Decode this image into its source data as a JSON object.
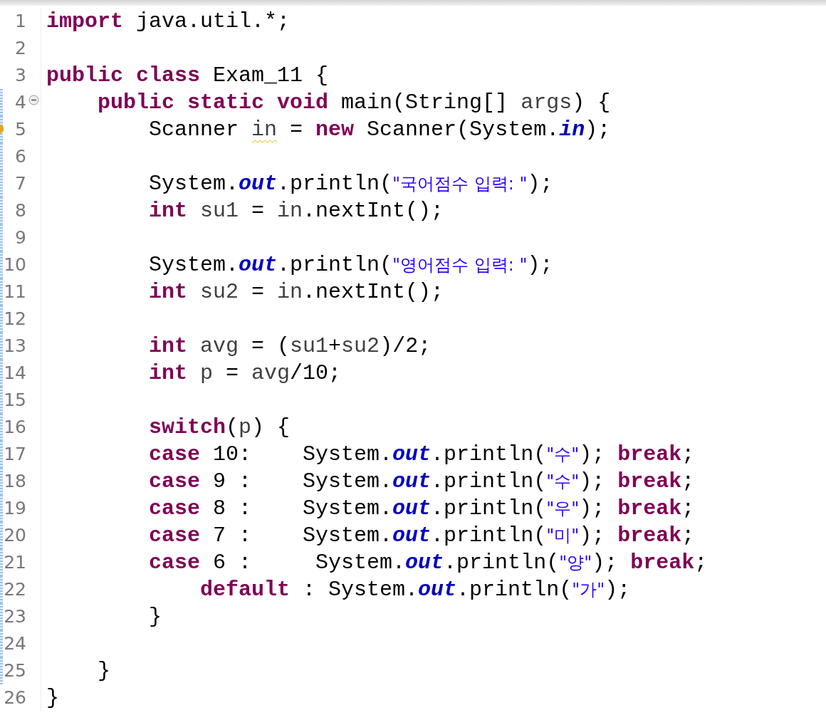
{
  "editor": {
    "lines": [
      {
        "number": "1",
        "changed": false,
        "foldable": false,
        "warning": false,
        "tokens": [
          {
            "kind": "keyword",
            "text": "import "
          },
          {
            "kind": "plain",
            "text": "java.util.*;"
          }
        ]
      },
      {
        "number": "2",
        "changed": false,
        "foldable": false,
        "warning": false
      },
      {
        "number": "3",
        "changed": false,
        "foldable": false,
        "warning": false,
        "tokens": [
          {
            "kind": "keyword",
            "text": "public class "
          },
          {
            "kind": "plain",
            "text": "Exam_11 {"
          }
        ]
      },
      {
        "number": "4",
        "changed": true,
        "foldable": true,
        "warning": false,
        "tokens": [
          {
            "kind": "keyword",
            "text": "    public static void "
          },
          {
            "kind": "plain",
            "text": "main(String[] "
          },
          {
            "kind": "variable",
            "text": "args"
          },
          {
            "kind": "plain",
            "text": ") {"
          }
        ]
      },
      {
        "number": "5",
        "changed": true,
        "foldable": false,
        "warning": true,
        "tokens": [
          {
            "kind": "plain",
            "text": "        Scanner "
          },
          {
            "kind": "warning",
            "text": "in"
          },
          {
            "kind": "plain",
            "text": " = "
          },
          {
            "kind": "keyword",
            "text": "new"
          },
          {
            "kind": "plain",
            "text": " Scanner(System."
          },
          {
            "kind": "field",
            "text": "in"
          },
          {
            "kind": "plain",
            "text": ");"
          }
        ]
      },
      {
        "number": "6",
        "changed": true,
        "foldable": false,
        "warning": false
      },
      {
        "number": "7",
        "changed": true,
        "foldable": false,
        "warning": false,
        "tokens": [
          {
            "kind": "plain",
            "text": "        System."
          },
          {
            "kind": "field",
            "text": "out"
          },
          {
            "kind": "plain",
            "text": ".println("
          },
          {
            "kind": "string",
            "text": "\"국어점수 입력: \""
          },
          {
            "kind": "plain",
            "text": ");"
          }
        ]
      },
      {
        "number": "8",
        "changed": true,
        "foldable": false,
        "warning": false,
        "tokens": [
          {
            "kind": "keyword",
            "text": "        int "
          },
          {
            "kind": "variable",
            "text": "su1"
          },
          {
            "kind": "plain",
            "text": " = "
          },
          {
            "kind": "variable",
            "text": "in"
          },
          {
            "kind": "plain",
            "text": ".nextInt();"
          }
        ]
      },
      {
        "number": "9",
        "changed": true,
        "foldable": false,
        "warning": false
      },
      {
        "number": "10",
        "changed": true,
        "foldable": false,
        "warning": false,
        "tokens": [
          {
            "kind": "plain",
            "text": "        System."
          },
          {
            "kind": "field",
            "text": "out"
          },
          {
            "kind": "plain",
            "text": ".println("
          },
          {
            "kind": "string",
            "text": "\"영어점수 입력: \""
          },
          {
            "kind": "plain",
            "text": ");"
          }
        ]
      },
      {
        "number": "11",
        "changed": true,
        "foldable": false,
        "warning": false,
        "tokens": [
          {
            "kind": "keyword",
            "text": "        int "
          },
          {
            "kind": "variable",
            "text": "su2"
          },
          {
            "kind": "plain",
            "text": " = "
          },
          {
            "kind": "variable",
            "text": "in"
          },
          {
            "kind": "plain",
            "text": ".nextInt();"
          }
        ]
      },
      {
        "number": "12",
        "changed": true,
        "foldable": false,
        "warning": false
      },
      {
        "number": "13",
        "changed": true,
        "foldable": false,
        "warning": false,
        "tokens": [
          {
            "kind": "keyword",
            "text": "        int "
          },
          {
            "kind": "variable",
            "text": "avg"
          },
          {
            "kind": "plain",
            "text": " = ("
          },
          {
            "kind": "variable",
            "text": "su1"
          },
          {
            "kind": "plain",
            "text": "+"
          },
          {
            "kind": "variable",
            "text": "su2"
          },
          {
            "kind": "plain",
            "text": ")/2;"
          }
        ]
      },
      {
        "number": "14",
        "changed": true,
        "foldable": false,
        "warning": false,
        "tokens": [
          {
            "kind": "keyword",
            "text": "        int "
          },
          {
            "kind": "variable",
            "text": "p"
          },
          {
            "kind": "plain",
            "text": " = "
          },
          {
            "kind": "variable",
            "text": "avg"
          },
          {
            "kind": "plain",
            "text": "/10;"
          }
        ]
      },
      {
        "number": "15",
        "changed": true,
        "foldable": false,
        "warning": false
      },
      {
        "number": "16",
        "changed": true,
        "foldable": false,
        "warning": false,
        "tokens": [
          {
            "kind": "keyword",
            "text": "        switch"
          },
          {
            "kind": "plain",
            "text": "("
          },
          {
            "kind": "variable",
            "text": "p"
          },
          {
            "kind": "plain",
            "text": ") {"
          }
        ]
      },
      {
        "number": "17",
        "changed": true,
        "foldable": false,
        "warning": false,
        "tokens": [
          {
            "kind": "keyword",
            "text": "        case"
          },
          {
            "kind": "plain",
            "text": " 10:    System."
          },
          {
            "kind": "field",
            "text": "out"
          },
          {
            "kind": "plain",
            "text": ".println("
          },
          {
            "kind": "string",
            "text": "\"수\""
          },
          {
            "kind": "plain",
            "text": "); "
          },
          {
            "kind": "keyword",
            "text": "break"
          },
          {
            "kind": "plain",
            "text": ";"
          }
        ]
      },
      {
        "number": "18",
        "changed": true,
        "foldable": false,
        "warning": false,
        "tokens": [
          {
            "kind": "keyword",
            "text": "        case"
          },
          {
            "kind": "plain",
            "text": " 9 :    System."
          },
          {
            "kind": "field",
            "text": "out"
          },
          {
            "kind": "plain",
            "text": ".println("
          },
          {
            "kind": "string",
            "text": "\"수\""
          },
          {
            "kind": "plain",
            "text": "); "
          },
          {
            "kind": "keyword",
            "text": "break"
          },
          {
            "kind": "plain",
            "text": ";"
          }
        ]
      },
      {
        "number": "19",
        "changed": true,
        "foldable": false,
        "warning": false,
        "tokens": [
          {
            "kind": "keyword",
            "text": "        case"
          },
          {
            "kind": "plain",
            "text": " 8 :    System."
          },
          {
            "kind": "field",
            "text": "out"
          },
          {
            "kind": "plain",
            "text": ".println("
          },
          {
            "kind": "string",
            "text": "\"우\""
          },
          {
            "kind": "plain",
            "text": "); "
          },
          {
            "kind": "keyword",
            "text": "break"
          },
          {
            "kind": "plain",
            "text": ";"
          }
        ]
      },
      {
        "number": "20",
        "changed": true,
        "foldable": false,
        "warning": false,
        "tokens": [
          {
            "kind": "keyword",
            "text": "        case"
          },
          {
            "kind": "plain",
            "text": " 7 :    System."
          },
          {
            "kind": "field",
            "text": "out"
          },
          {
            "kind": "plain",
            "text": ".println("
          },
          {
            "kind": "string",
            "text": "\"미\""
          },
          {
            "kind": "plain",
            "text": "); "
          },
          {
            "kind": "keyword",
            "text": "break"
          },
          {
            "kind": "plain",
            "text": ";"
          }
        ]
      },
      {
        "number": "21",
        "changed": true,
        "foldable": false,
        "warning": false,
        "tokens": [
          {
            "kind": "keyword",
            "text": "        case"
          },
          {
            "kind": "plain",
            "text": " 6 :     System."
          },
          {
            "kind": "field",
            "text": "out"
          },
          {
            "kind": "plain",
            "text": ".println("
          },
          {
            "kind": "string",
            "text": "\"양\""
          },
          {
            "kind": "plain",
            "text": "); "
          },
          {
            "kind": "keyword",
            "text": "break"
          },
          {
            "kind": "plain",
            "text": ";"
          }
        ]
      },
      {
        "number": "22",
        "changed": true,
        "foldable": false,
        "warning": false,
        "tokens": [
          {
            "kind": "keyword",
            "text": "            default"
          },
          {
            "kind": "plain",
            "text": " : System."
          },
          {
            "kind": "field",
            "text": "out"
          },
          {
            "kind": "plain",
            "text": ".println("
          },
          {
            "kind": "string",
            "text": "\"가\""
          },
          {
            "kind": "plain",
            "text": ");"
          }
        ]
      },
      {
        "number": "23",
        "changed": true,
        "foldable": false,
        "warning": false,
        "tokens": [
          {
            "kind": "plain",
            "text": "        }"
          }
        ]
      },
      {
        "number": "24",
        "changed": true,
        "foldable": false,
        "warning": false
      },
      {
        "number": "25",
        "changed": true,
        "foldable": false,
        "warning": false,
        "tokens": [
          {
            "kind": "plain",
            "text": "    }"
          }
        ]
      },
      {
        "number": "26",
        "changed": false,
        "foldable": false,
        "warning": false,
        "tokens": [
          {
            "kind": "plain",
            "text": "}"
          }
        ]
      }
    ]
  }
}
